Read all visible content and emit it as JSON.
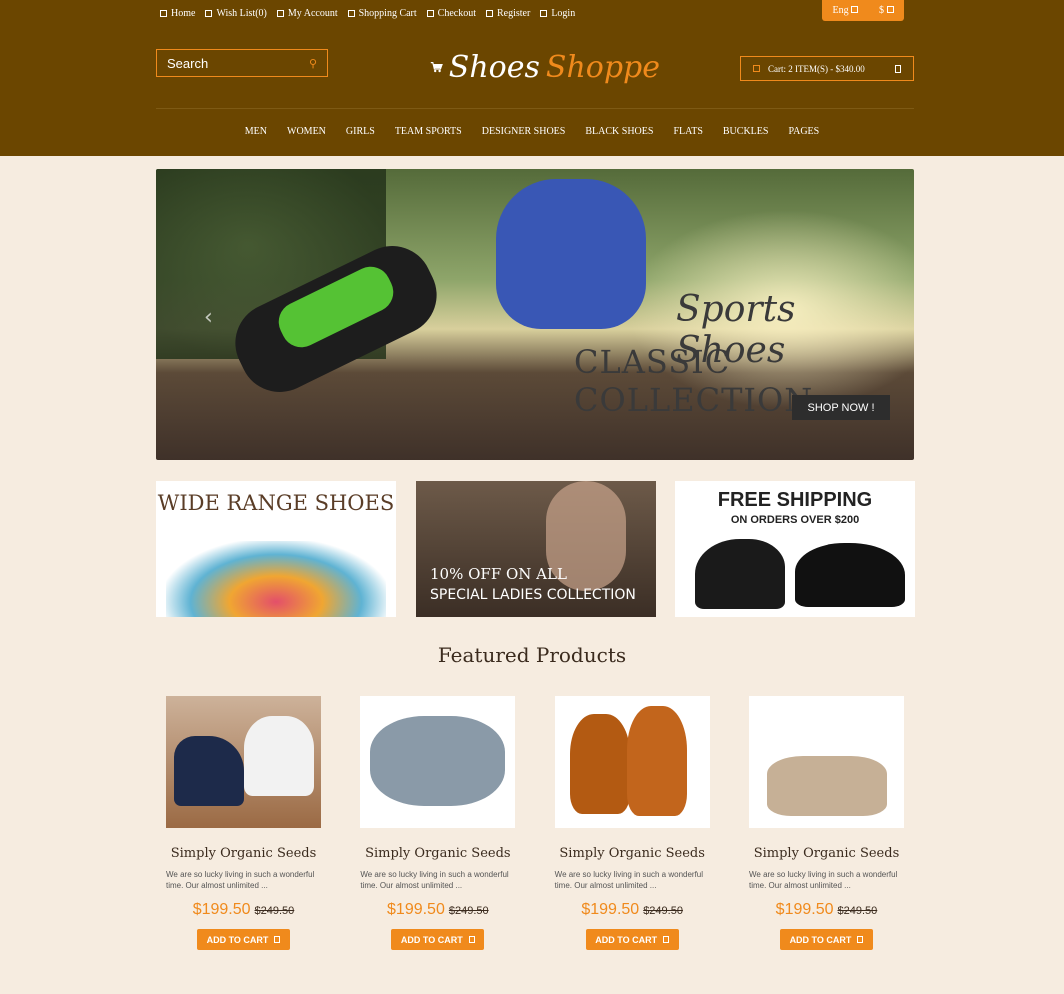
{
  "topbar": {
    "links": [
      "Home",
      "Wish List(0)",
      "My Account",
      "Shopping Cart",
      "Checkout",
      "Register",
      "Login"
    ],
    "lang": "Eng",
    "currency": "$"
  },
  "search": {
    "placeholder": "Search"
  },
  "logo": {
    "word1": "Shoes",
    "word2": "Shoppe"
  },
  "cart": {
    "label": "Cart: 2 ITEM(S) - $340.00"
  },
  "nav": [
    "MEN",
    "WOMEN",
    "GIRLS",
    "TEAM SPORTS",
    "DESIGNER SHOES",
    "BLACK SHOES",
    "FLATS",
    "BUCKLES",
    "PAGES"
  ],
  "slider": {
    "title1": "Sports Shoes",
    "title2": "CLASSIC COLLECTION",
    "cta": "SHOP NOW !"
  },
  "banners": {
    "b1": {
      "title": "WIDE RANGE SHOES"
    },
    "b2": {
      "line1": "10% OFF ON ALL",
      "line2": "SPECIAL LADIES COLLECTION"
    },
    "b3": {
      "line1": "FREE SHIPPING",
      "line2": "ON ORDERS OVER $200"
    }
  },
  "featured": {
    "title": "Featured Products"
  },
  "products": [
    {
      "name": "Simply Organic Seeds",
      "desc": "We are so lucky living in such a wonderful time. Our almost unlimited ...",
      "price": "$199.50",
      "old_price": "$249.50",
      "button": "ADD TO CART"
    },
    {
      "name": "Simply Organic Seeds",
      "desc": "We are so lucky living in such a wonderful time. Our almost unlimited ...",
      "price": "$199.50",
      "old_price": "$249.50",
      "button": "ADD TO CART"
    },
    {
      "name": "Simply Organic Seeds",
      "desc": "We are so lucky living in such a wonderful time. Our almost unlimited ...",
      "price": "$199.50",
      "old_price": "$249.50",
      "button": "ADD TO CART"
    },
    {
      "name": "Simply Organic Seeds",
      "desc": "We are so lucky living in such a wonderful time. Our almost unlimited ...",
      "price": "$199.50",
      "old_price": "$249.50",
      "button": "ADD TO CART"
    }
  ],
  "colors": {
    "header_bg": "#6b4600",
    "accent": "#f08a1c",
    "page_bg": "#f6ece0"
  }
}
